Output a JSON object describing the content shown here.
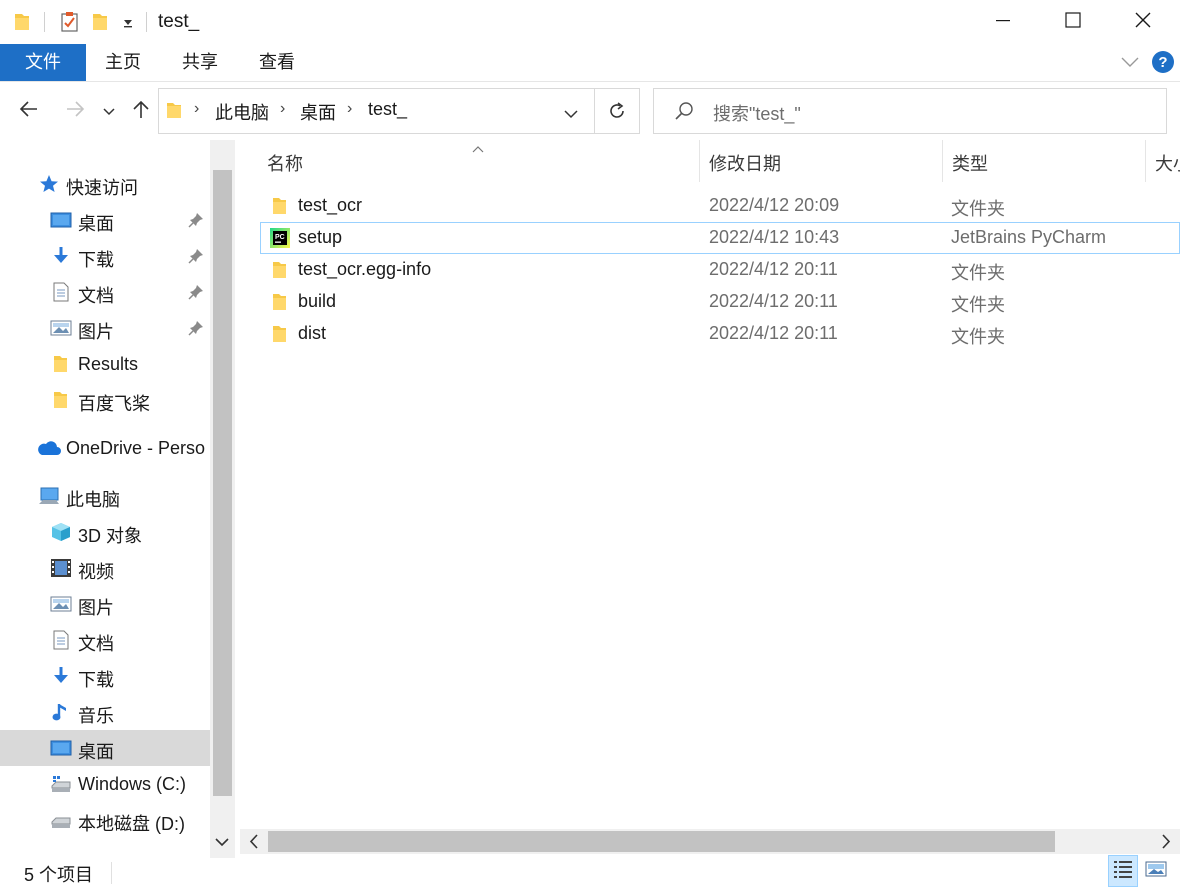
{
  "window": {
    "title": "test_",
    "minimize_icon": "minimize-icon",
    "maximize_icon": "maximize-icon",
    "close_icon": "close-icon"
  },
  "ribbon": {
    "tabs": [
      "文件",
      "主页",
      "共享",
      "查看"
    ]
  },
  "nav": {
    "breadcrumbs": [
      "此电脑",
      "桌面",
      "test_"
    ],
    "search_placeholder": "搜索\"test_\""
  },
  "sidebar": {
    "quick_access": "快速访问",
    "quick_items": [
      {
        "label": "桌面",
        "pinned": true
      },
      {
        "label": "下载",
        "pinned": true
      },
      {
        "label": "文档",
        "pinned": true
      },
      {
        "label": "图片",
        "pinned": true
      },
      {
        "label": "Results",
        "pinned": false
      },
      {
        "label": "百度飞桨",
        "pinned": false
      }
    ],
    "onedrive": "OneDrive - Perso",
    "this_pc": "此电脑",
    "pc_items": [
      "3D 对象",
      "视频",
      "图片",
      "文档",
      "下载",
      "音乐",
      "桌面",
      "Windows  (C:)",
      "本地磁盘 (D:)"
    ],
    "selected": "桌面"
  },
  "columns": {
    "name": "名称",
    "date": "修改日期",
    "type": "类型",
    "size": "大小"
  },
  "files": [
    {
      "name": "test_ocr",
      "date": "2022/4/12 20:09",
      "type": "文件夹",
      "icon": "folder-icon"
    },
    {
      "name": "setup",
      "date": "2022/4/12 10:43",
      "type": "JetBrains PyCharm",
      "icon": "pycharm-icon"
    },
    {
      "name": "test_ocr.egg-info",
      "date": "2022/4/12 20:11",
      "type": "文件夹",
      "icon": "folder-icon"
    },
    {
      "name": "build",
      "date": "2022/4/12 20:11",
      "type": "文件夹",
      "icon": "folder-icon"
    },
    {
      "name": "dist",
      "date": "2022/4/12 20:11",
      "type": "文件夹",
      "icon": "folder-icon"
    }
  ],
  "status": {
    "item_count": "5 个项目"
  },
  "colors": {
    "accent": "#1e6fc6",
    "folder": "#f7c948",
    "selection_border": "#99d1ff"
  }
}
